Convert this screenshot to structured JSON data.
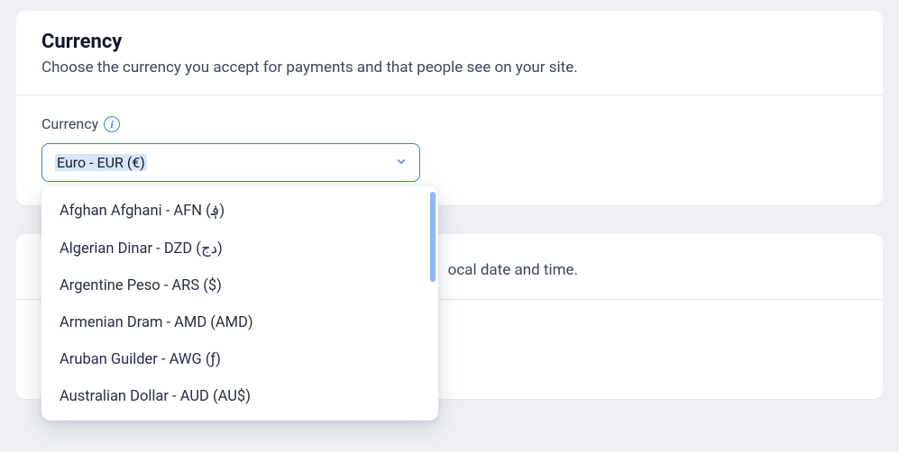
{
  "currency_card": {
    "title": "Currency",
    "subtitle": "Choose the currency you accept for payments and that people see on your site.",
    "field_label": "Currency",
    "selected": "Euro - EUR (€)",
    "options": [
      "Afghan Afghani - AFN (؋)",
      "Algerian Dinar - DZD (دج)",
      "Argentine Peso - ARS ($)",
      "Armenian Dram - AMD (AMD)",
      "Aruban Guilder - AWG (ƒ)",
      "Australian Dollar - AUD (AU$)"
    ]
  },
  "second_card": {
    "subtitle_suffix": "ocal date and time."
  }
}
